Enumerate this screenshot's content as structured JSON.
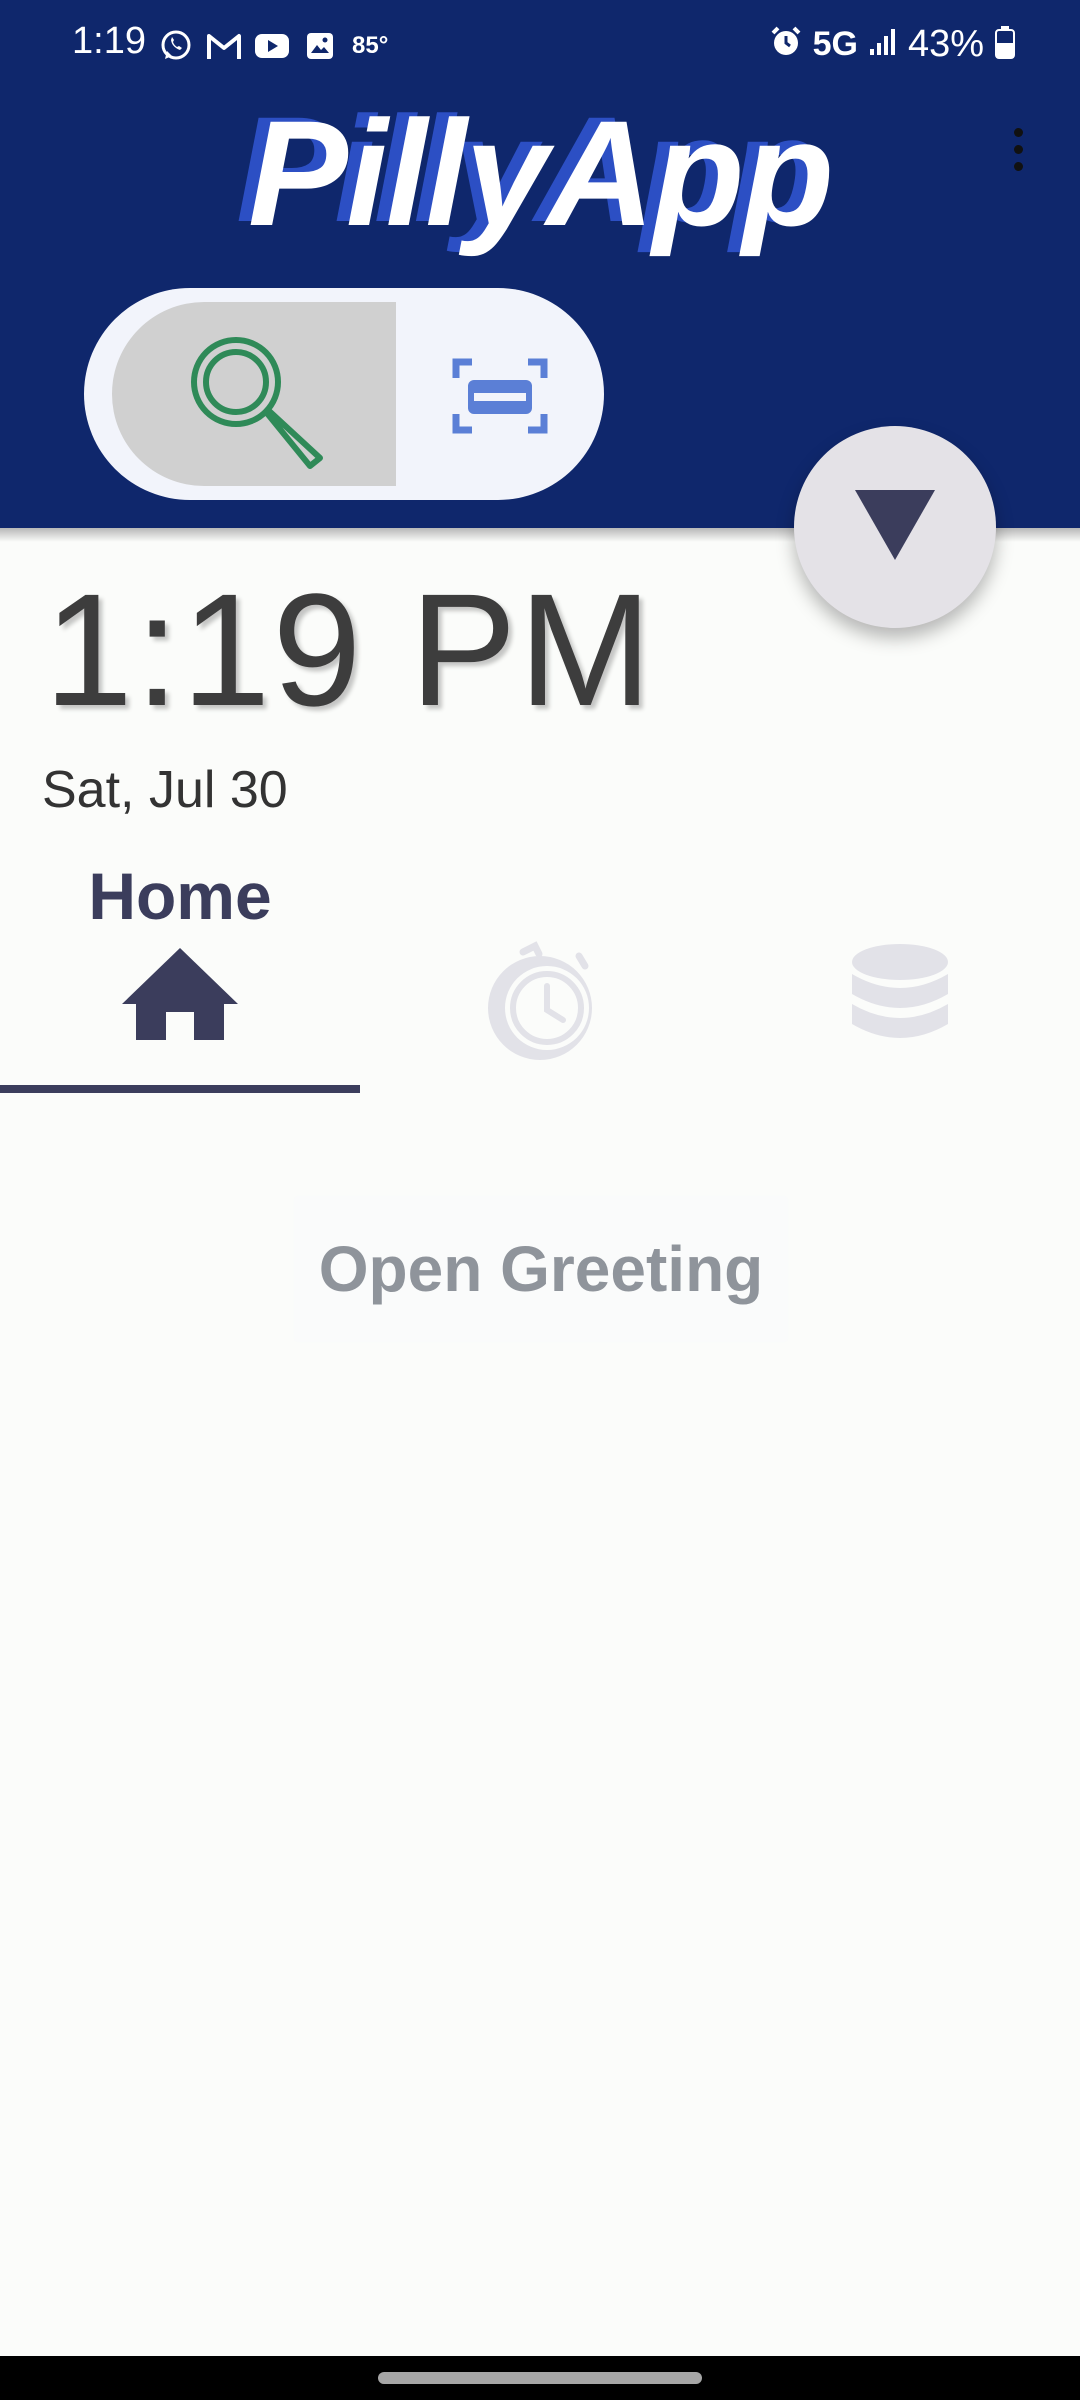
{
  "status_bar": {
    "time": "1:19",
    "temperature": "85°",
    "network": "5G",
    "battery": "43%",
    "left_icons": [
      "whatsapp-icon",
      "gmail-icon",
      "youtube-icon",
      "gallery-icon"
    ],
    "right_icons": [
      "alarm-icon",
      "signal-icon",
      "battery-icon"
    ]
  },
  "header": {
    "app_title": "PillyApp",
    "colors": {
      "background": "#0f276c",
      "title_shadow": "#2c4fc4"
    }
  },
  "mode_toggle": {
    "search_icon": "search-icon",
    "scan_icon": "scan-icon",
    "selected": "search",
    "colors": {
      "search": "#2f8a58",
      "scan": "#5b7fd6"
    }
  },
  "fab": {
    "icon": "triangle-down-icon"
  },
  "clock": {
    "time": "1:19 PM",
    "date": "Sat, Jul 30"
  },
  "tabs": {
    "active_label": "Home",
    "items": [
      {
        "icon": "home-icon",
        "active": true
      },
      {
        "icon": "alarm-clock-icon",
        "active": false
      },
      {
        "icon": "database-icon",
        "active": false
      }
    ]
  },
  "main": {
    "greeting_button": "Open Greeting"
  }
}
